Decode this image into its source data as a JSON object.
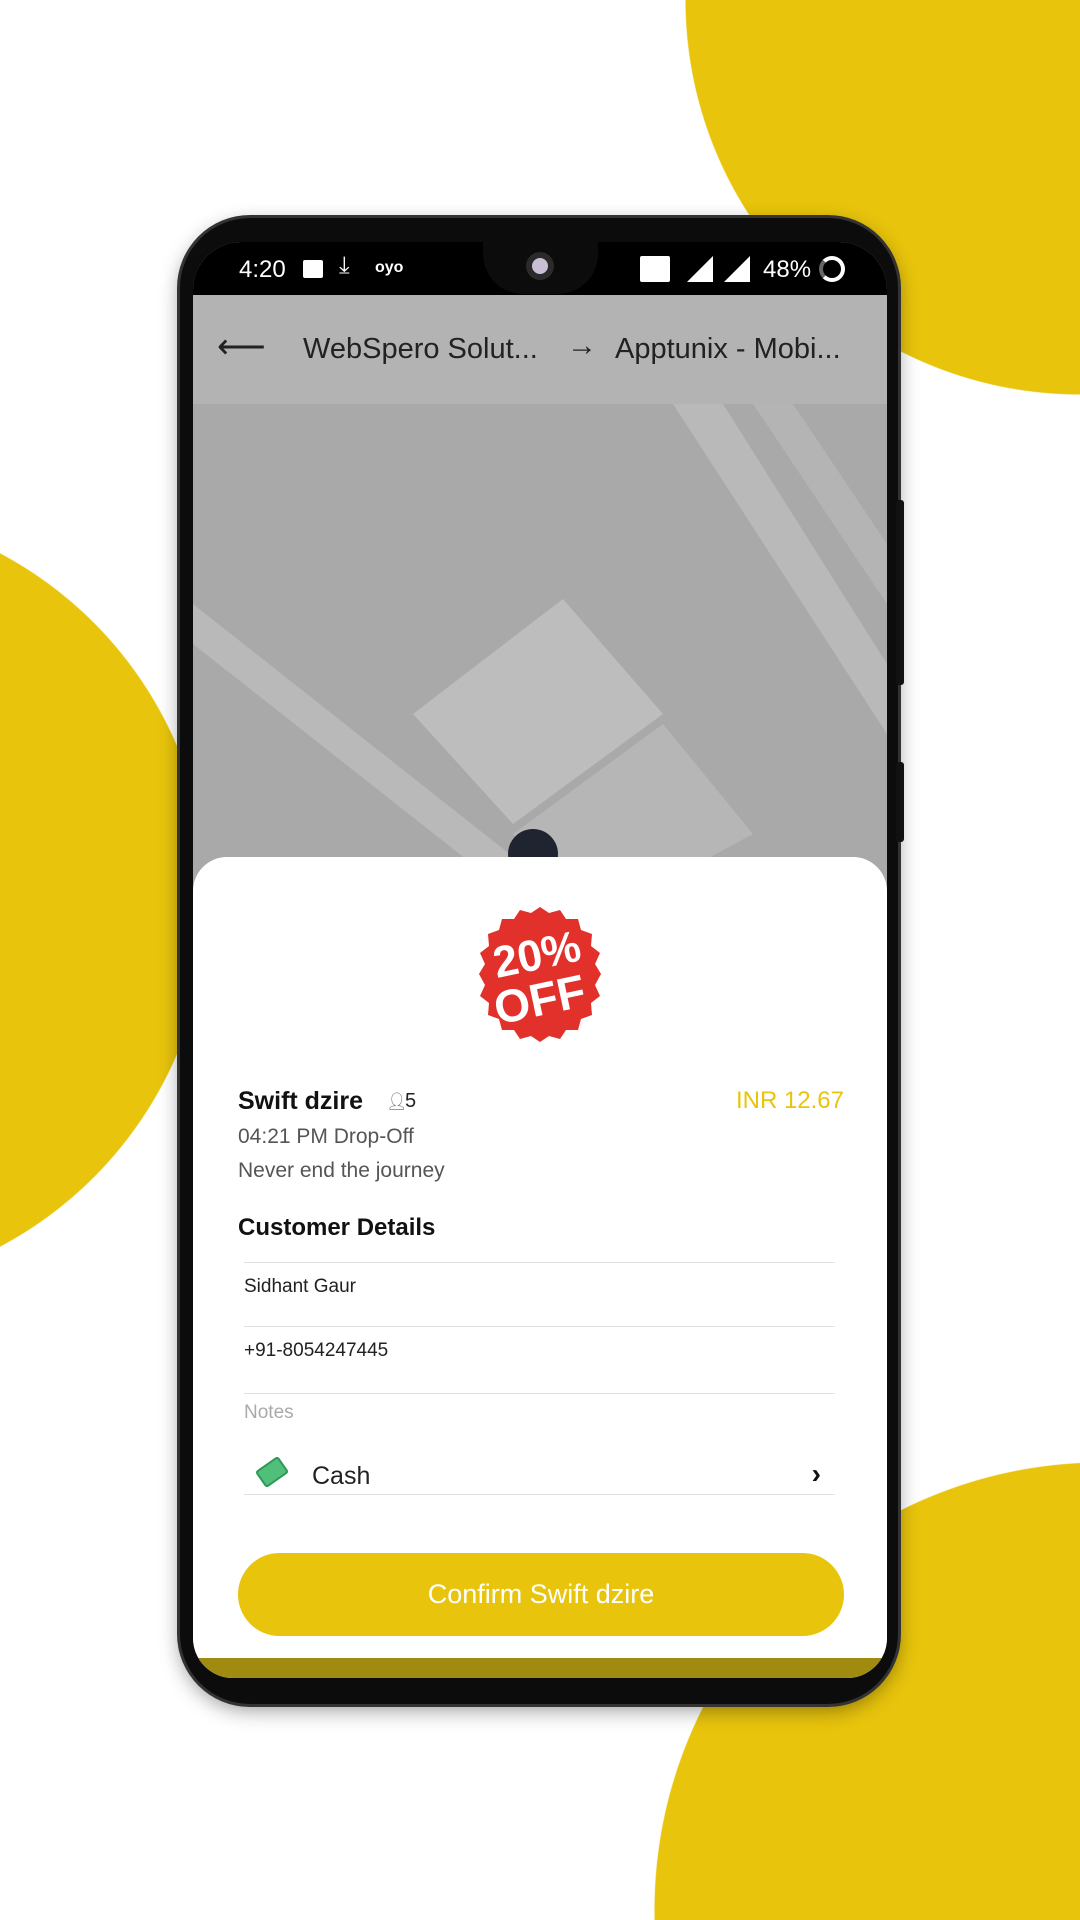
{
  "status_bar": {
    "time": "4:20",
    "carrier_icon_text": "oyo",
    "battery": "48%"
  },
  "header": {
    "origin": "WebSpero Solut...",
    "destination": "Apptunix - Mobi..."
  },
  "promo": {
    "line1": "20%",
    "line2": "OFF"
  },
  "ride": {
    "name": "Swift dzire",
    "seats": "5",
    "price": "INR 12.67",
    "dropoff": "04:21 PM Drop-Off",
    "tagline": "Never end the journey"
  },
  "customer": {
    "title": "Customer Details",
    "name": "Sidhant Gaur",
    "phone": "+91-8054247445",
    "notes_placeholder": "Notes"
  },
  "payment": {
    "method": "Cash"
  },
  "confirm_label": "Confirm Swift dzire",
  "colors": {
    "accent": "#E8C40C",
    "promo_red": "#E2302B"
  }
}
